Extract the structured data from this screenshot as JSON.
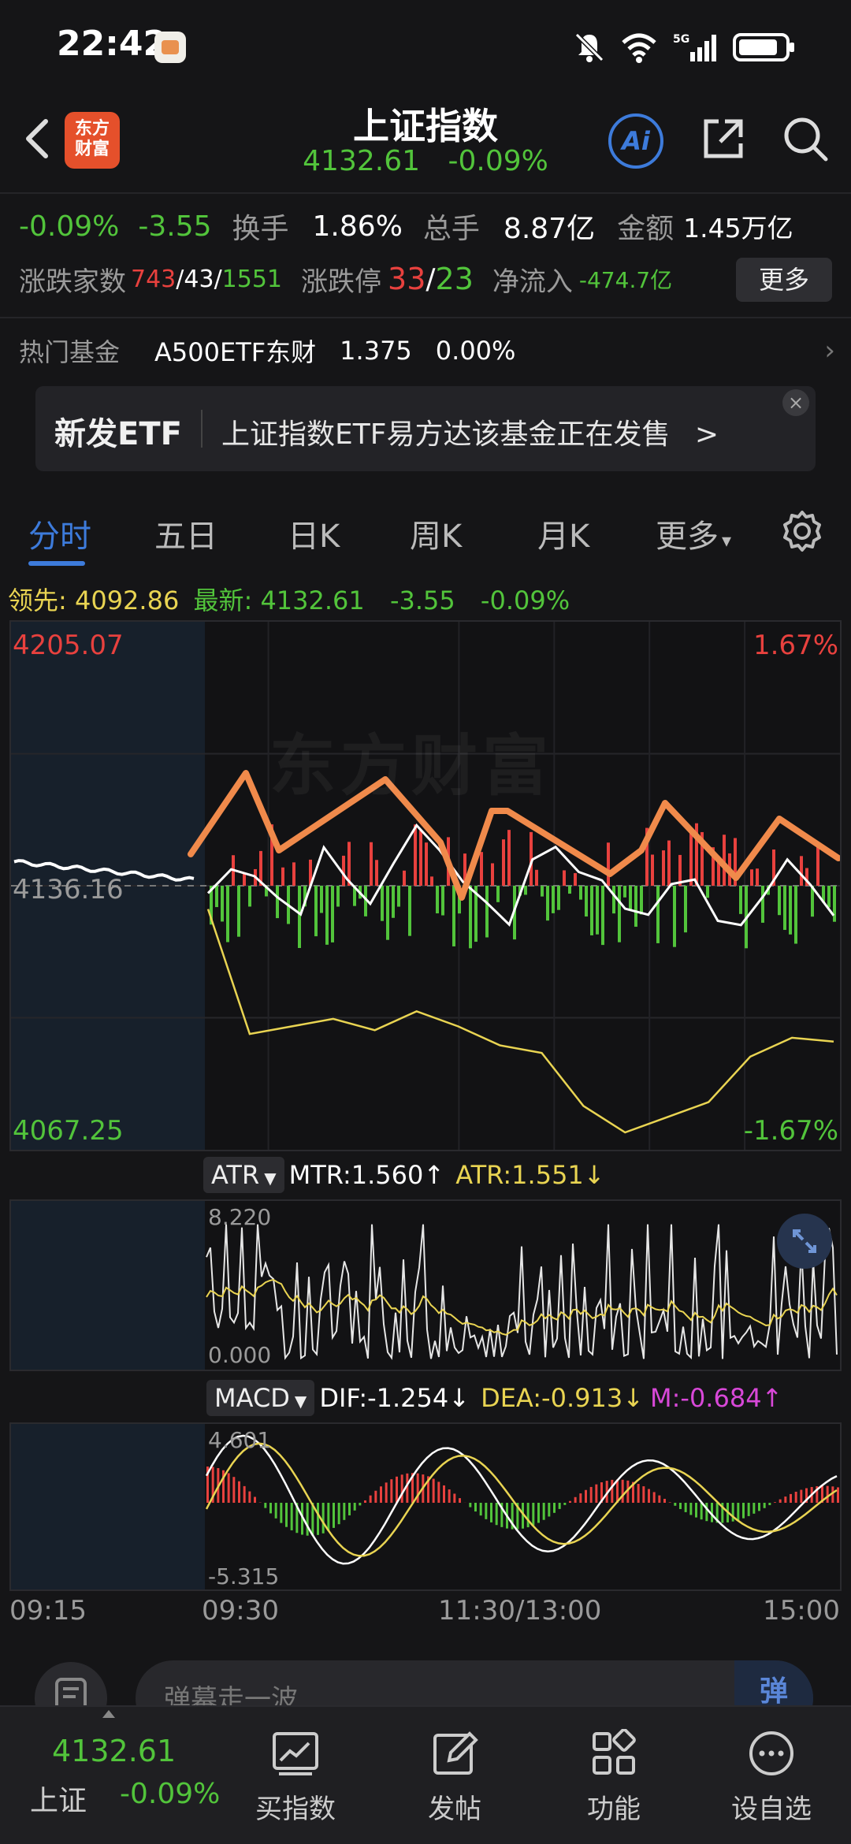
{
  "status": {
    "time": "22:42"
  },
  "header": {
    "logo_line1": "东方",
    "logo_line2": "财富",
    "title": "上证指数",
    "price": "4132.61",
    "change_pct": "-0.09%",
    "ai_label": "Ai"
  },
  "stats": {
    "pct": "-0.09%",
    "chg": "-3.55",
    "turnover_label": "换手",
    "turnover": "1.86%",
    "volume_label": "总手",
    "volume": "8.87亿",
    "amount_label": "金额",
    "amount": "1.45万亿",
    "breadth_label": "涨跌家数",
    "breadth_up": "743",
    "breadth_flat": "43",
    "breadth_down": "1551",
    "limit_label": "涨跌停",
    "limit_up": "33",
    "limit_down": "23",
    "netflow_label": "净流入",
    "netflow": "-474.7亿",
    "more_label": "更多"
  },
  "hot_fund": {
    "label": "热门基金",
    "name": "A500ETF东财",
    "price": "1.375",
    "pct": "0.00%"
  },
  "etf_banner": {
    "tag": "新发ETF",
    "text": "上证指数ETF易方达该基金正在发售",
    "arrow": ">",
    "close": "×"
  },
  "tabs": [
    "分时",
    "五日",
    "日K",
    "周K",
    "月K",
    "更多"
  ],
  "tab_more_arrow": "▾",
  "info": {
    "lead_label": "领先:",
    "lead_value": "4092.86",
    "last_label": "最新:",
    "last_value": "4132.61",
    "chg": "-3.55",
    "pct": "-0.09%"
  },
  "main_chart": {
    "y_high": "4205.07",
    "y_low": "4067.25",
    "y_ref": "4136.16",
    "pct_high": "1.67%",
    "pct_low": "-1.67%",
    "watermark": "东方财富"
  },
  "atr": {
    "name": "ATR",
    "mtr": "MTR:1.560",
    "mtr_arrow": "↑",
    "atr": "ATR:1.551",
    "atr_arrow": "↓",
    "y_max": "8.220",
    "y_min": "0.000"
  },
  "macd": {
    "name": "MACD",
    "dif": "DIF:-1.254",
    "dif_arrow": "↓",
    "dea": "DEA:-0.913",
    "dea_arrow": "↓",
    "m": "M:-0.684",
    "m_arrow": "↑",
    "y_max": "4.601",
    "y_min": "-5.315"
  },
  "time_axis": [
    "09:15",
    "09:30",
    "11:30/13:00",
    "15:00"
  ],
  "comment": {
    "placeholder": "弹幕走一波",
    "toggle": "弹"
  },
  "bottom_nav": {
    "index_price": "4132.61",
    "index_name": "上证",
    "index_pct": "-0.09%",
    "items": [
      "买指数",
      "发帖",
      "功能",
      "设自选"
    ]
  },
  "colors": {
    "up": "#e8413e",
    "down": "#52c43b",
    "accent": "#3d7bdb",
    "annotation": "#f08a4b",
    "avg_line": "#e9d452"
  },
  "chart_data": {
    "type": "line",
    "series": [
      {
        "values": [
          4134.2,
          4140.5,
          4138.7,
          4133.1,
          4128.6,
          4146.3,
          4137.9,
          4131.4,
          4142.0,
          4152.1,
          4145.5,
          4137.2,
          4131.8,
          4125.9,
          4143.1,
          4146.4,
          4139.8,
          4137.6,
          4130.1,
          4128.5,
          4136.6,
          4137.8,
          4126.9,
          4125.8,
          4133.7,
          4143.1,
          4136.4,
          4128.3
        ]
      },
      {
        "values": [
          4130,
          4097,
          4099,
          4101,
          4098,
          4103,
          4099,
          4094,
          4092,
          4078,
          4071,
          4075,
          4079,
          4091,
          4096,
          4095
        ]
      }
    ],
    "ylim": [
      4067.25,
      4205.07
    ]
  }
}
